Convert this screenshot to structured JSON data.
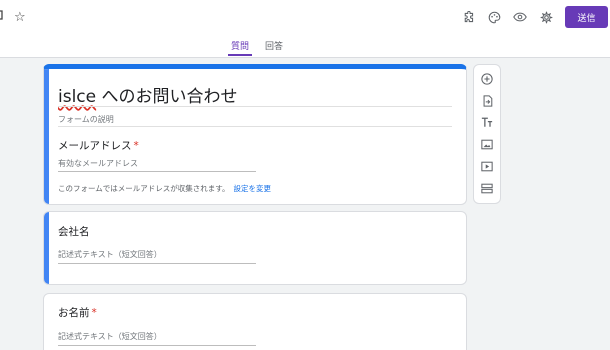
{
  "header": {
    "star_glyph": "☆",
    "send_label": "送信",
    "icons": [
      "addon-icon",
      "palette-icon",
      "preview-eye-icon",
      "settings-gear-icon"
    ]
  },
  "tabs": [
    {
      "label": "質問",
      "active": true
    },
    {
      "label": "回答",
      "active": false
    }
  ],
  "form": {
    "title_prefix": "islce",
    "title_rest": " へのお問い合わせ",
    "description_placeholder": "フォームの説明"
  },
  "email_question": {
    "label": "メールアドレス",
    "required_mark": "*",
    "placeholder": "有効なメールアドレス",
    "note": "このフォームではメールアドレスが収集されます。",
    "note_link": "設定を変更"
  },
  "questions": [
    {
      "label": "会社名",
      "required_mark": "",
      "placeholder": "記述式テキスト（短文回答）"
    },
    {
      "label": "お名前",
      "required_mark": "*",
      "placeholder": "記述式テキスト（短文回答）"
    }
  ],
  "side_tools": [
    "add-question-icon",
    "import-questions-icon",
    "add-title-icon",
    "add-image-icon",
    "add-video-icon",
    "add-section-icon"
  ],
  "colors": {
    "accent": "#673ab7",
    "focus_bar": "#4285f4",
    "link": "#1a73e8",
    "required": "#d93025"
  }
}
